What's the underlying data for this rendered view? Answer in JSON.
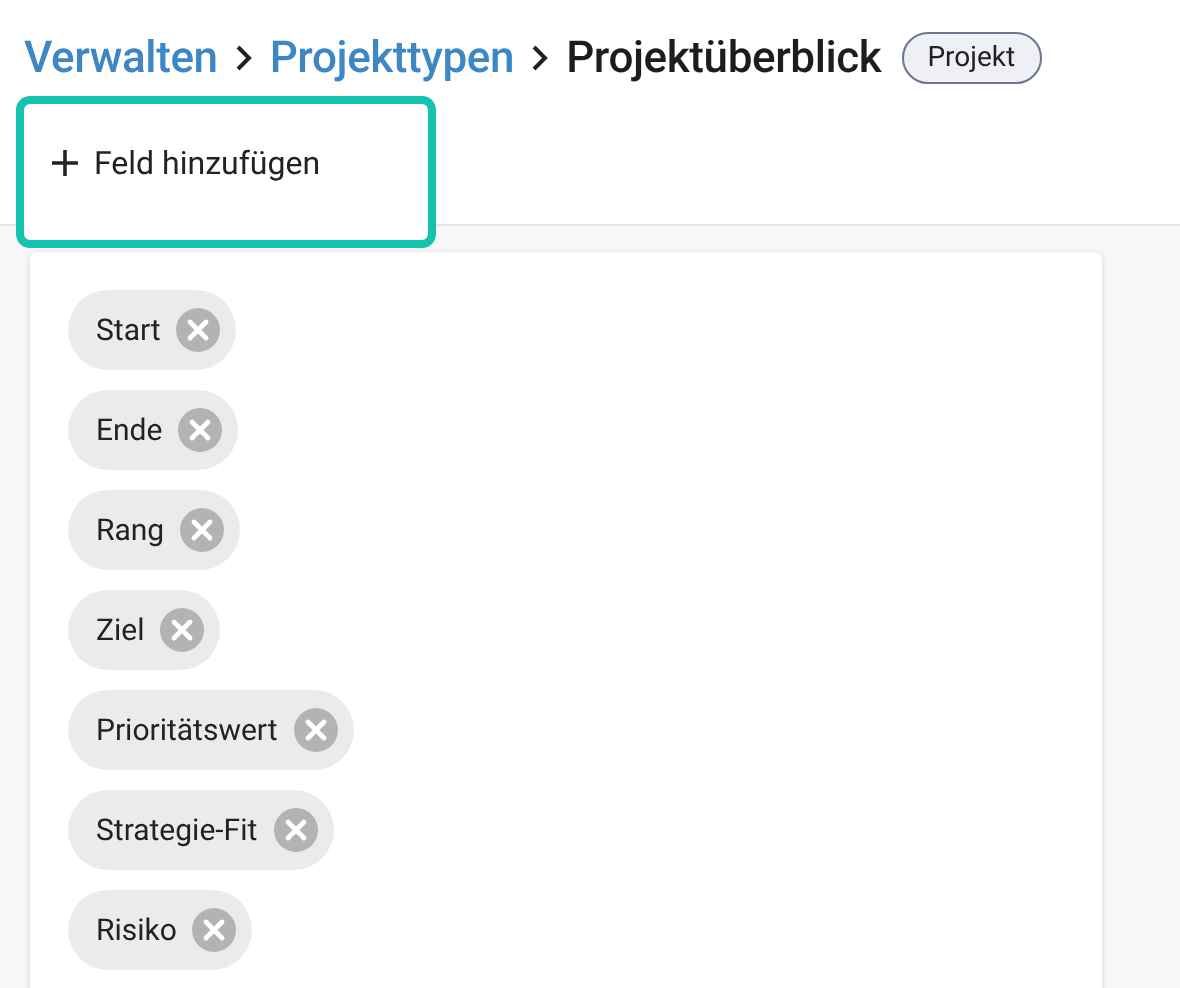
{
  "breadcrumb": [
    {
      "label": "Verwalten",
      "kind": "link"
    },
    {
      "label": "Projekttypen",
      "kind": "link"
    },
    {
      "label": "Projektüberblick",
      "kind": "current"
    }
  ],
  "badge": "Projekt",
  "add_button": {
    "label": "Feld hinzufügen",
    "highlighted": true
  },
  "fields": [
    {
      "label": "Start"
    },
    {
      "label": "Ende"
    },
    {
      "label": "Rang"
    },
    {
      "label": "Ziel"
    },
    {
      "label": "Prioritätswert"
    },
    {
      "label": "Strategie-Fit"
    },
    {
      "label": "Risiko"
    }
  ]
}
